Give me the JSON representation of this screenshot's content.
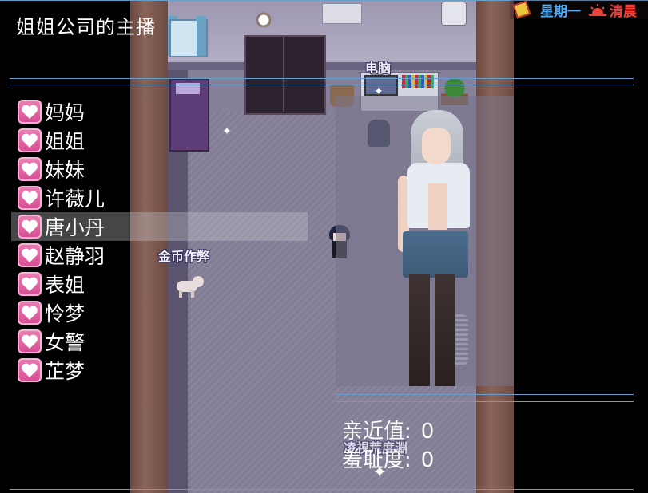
{
  "title": "姐姐公司的主播",
  "hud": {
    "weekday": "星期一",
    "time_of_day": "清晨",
    "calendar_icon": "calendar-icon",
    "sun_icon": "sunrise-icon",
    "weekday_color": "#4fa9f2",
    "time_color": "#f0403c"
  },
  "menu": {
    "icon": "heart-icon",
    "selected_index": 4,
    "items": [
      {
        "label": "妈妈"
      },
      {
        "label": "姐姐"
      },
      {
        "label": "妹妹"
      },
      {
        "label": "许薇儿"
      },
      {
        "label": "唐小丹"
      },
      {
        "label": "赵静羽"
      },
      {
        "label": "表姐"
      },
      {
        "label": "怜梦"
      },
      {
        "label": "女警"
      },
      {
        "label": "芷梦"
      }
    ]
  },
  "map_labels": {
    "computer": "电脑",
    "gold_cheat": "金币作弊",
    "hidden_label": "凌視荒度淵"
  },
  "stats": {
    "affinity_label": "亲近值:",
    "affinity_value": "0",
    "shame_label": "羞耻度:",
    "shame_value": "0"
  }
}
